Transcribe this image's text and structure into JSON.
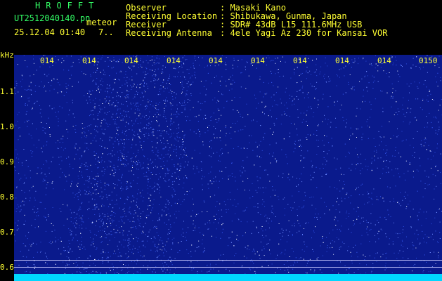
{
  "header": {
    "brand": "HROFFT",
    "filename": "UT2512040140.pn",
    "mode": "meteor",
    "date_time": "25.12.04 01:40",
    "count": "7..",
    "fields": [
      {
        "label": "Observer",
        "value": ": Masaki Kano"
      },
      {
        "label": "Receiving Location",
        "value": ": Shibukawa, Gunma, Japan"
      },
      {
        "label": "Receiver",
        "value": ": SDR# 43dB L15 111.6MHz USB"
      },
      {
        "label": "Receiving Antenna",
        "value": ": 4ele Yagi Az 230 for Kansai VOR"
      }
    ]
  },
  "axis": {
    "unit": "kHz",
    "y_ticks": [
      "1.1",
      "1.0",
      "0.9",
      "0.8",
      "0.7",
      "0.6"
    ],
    "x_ticks": [
      "014",
      "014",
      "014",
      "014",
      "014",
      "014",
      "014",
      "014",
      "014",
      "0150"
    ]
  },
  "colors": {
    "background": "#000000",
    "header_green": "#33ff66",
    "label_yellow": "#ffff33",
    "plot_blue": "#0a1a8c",
    "noise_cyan": "#00d7ff"
  }
}
